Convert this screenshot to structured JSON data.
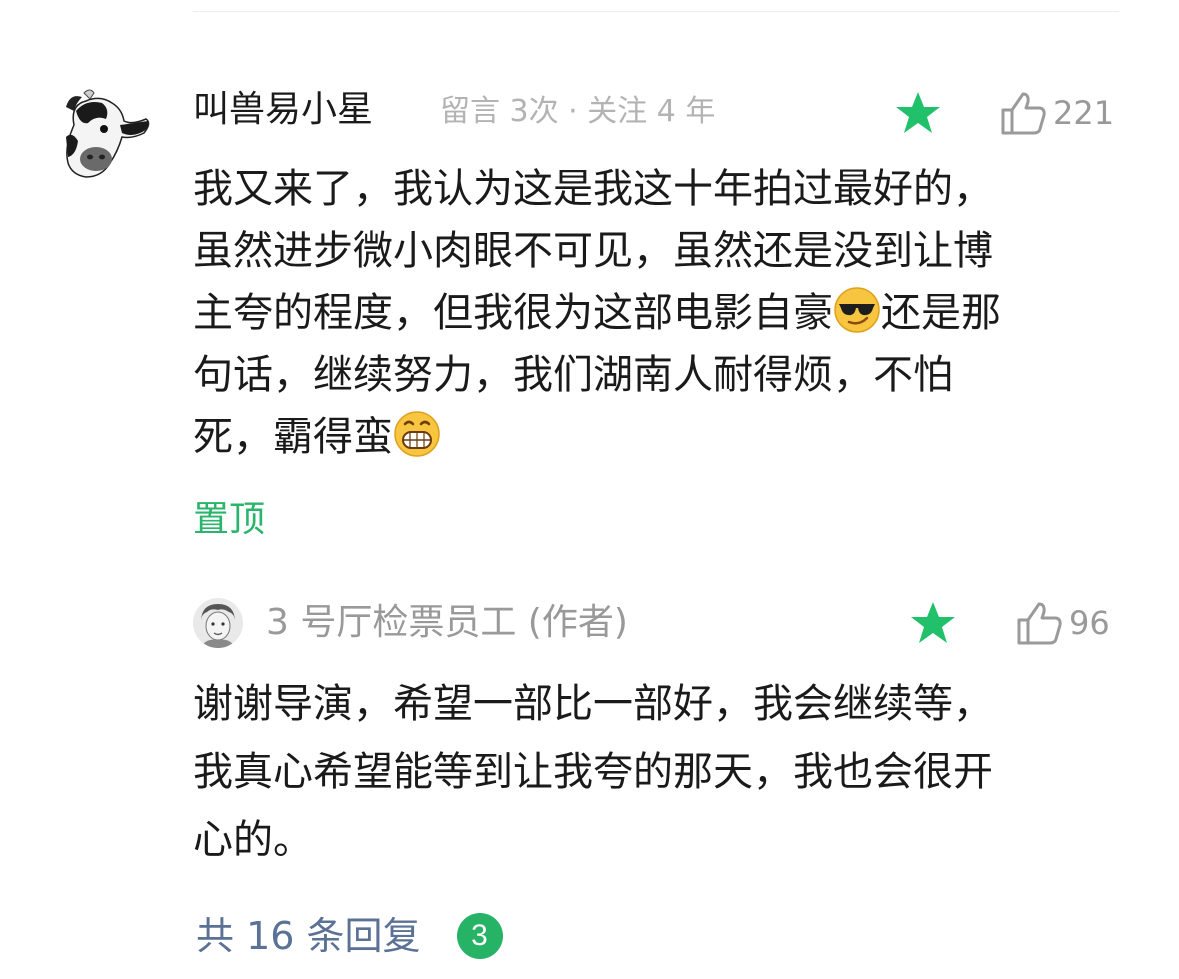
{
  "main_comment": {
    "username": "叫兽易小星",
    "meta": "留言 3次 · 关注 4 年",
    "like_count": "221",
    "content_lines": [
      "我又来了，我认为这是我这十年拍过最好的，",
      "虽然进步微小肉眼不可见，虽然还是没到让博",
      "主夸的程度，但我很为这部电影自豪",
      "还是那",
      "句话，继续努力，我们湖南人耐得烦，不怕",
      "死，霸得蛮"
    ],
    "pin_label": "置顶"
  },
  "reply": {
    "username": "3 号厅检票员工 (作者)",
    "like_count": "96",
    "content_lines": [
      "谢谢导演，希望一部比一部好，我会继续等，",
      "我真心希望能等到让我夸的那天，我也会很开",
      "心的。"
    ]
  },
  "replies_link": {
    "label": "共 16 条回复",
    "badge_count": "3"
  },
  "colors": {
    "star_green": "#21c16b",
    "pin_green": "#2ab56b",
    "link_blue": "#5b7196",
    "badge_green": "#26b365",
    "meta_gray": "#b3b3b3"
  },
  "icons": {
    "star": "star-icon",
    "like": "thumbs-up-icon",
    "emoji_1": "sunglasses-emoji",
    "emoji_2": "grinning-emoji"
  }
}
